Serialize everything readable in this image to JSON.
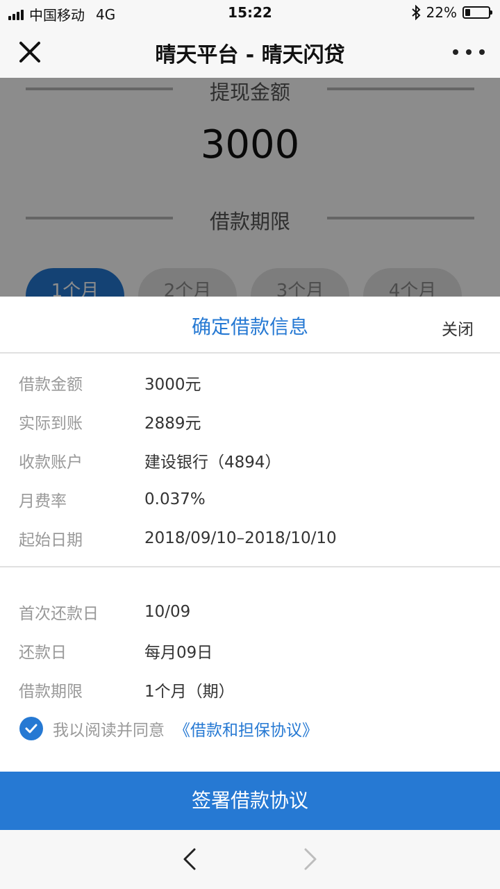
{
  "status_bar": {
    "carrier": "中国移动",
    "network": "4G",
    "time": "15:22",
    "battery": "22%",
    "battery_level": 0.22
  },
  "nav": {
    "title": "晴天平台 - 晴天闪贷"
  },
  "background": {
    "withdraw_label": "提现金额",
    "withdraw_amount": "3000",
    "term_label": "借款期限",
    "terms": [
      "1个月",
      "2个月",
      "3个月",
      "4个月"
    ],
    "selected_term": "1个月"
  },
  "sheet": {
    "title": "确定借款信息",
    "close_label": "关闭",
    "details": [
      {
        "label": "借款金额",
        "value": "3000元"
      },
      {
        "label": "实际到账",
        "value": "2889元"
      },
      {
        "label": "收款账户",
        "value": "建设银行（4894）"
      },
      {
        "label": "月费率",
        "value": "0.037%"
      },
      {
        "label": "起始日期",
        "value": "2018/09/10–2018/10/10"
      }
    ],
    "repayment": [
      {
        "label": "首次还款日",
        "value": "10/09"
      },
      {
        "label": "还款日",
        "value": "每月09日"
      },
      {
        "label": "借款期限",
        "value": "1个月（期）"
      }
    ],
    "agreement": {
      "checked": true,
      "text": "我以阅读并同意",
      "link": "《借款和担保协议》"
    },
    "submit_label": "签署借款协议"
  },
  "colors": {
    "accent": "#2679d3",
    "muted_text": "#999999",
    "overlay": "rgba(0,0,0,0.45)"
  },
  "icons": {
    "close": "close-icon",
    "more": "more-dots-icon",
    "back": "chevron-left-icon",
    "forward": "chevron-right-icon",
    "bluetooth": "bluetooth-icon",
    "check": "checkmark-icon"
  }
}
